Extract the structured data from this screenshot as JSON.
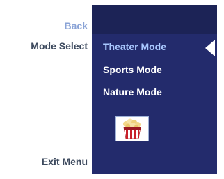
{
  "menu": {
    "back_label": "Back",
    "section_label": "Mode Select",
    "exit_label": "Exit Menu",
    "options": [
      {
        "label": "Theater Mode",
        "selected": true
      },
      {
        "label": "Sports Mode",
        "selected": false
      },
      {
        "label": "Nature Mode",
        "selected": false
      }
    ],
    "selected_icon": "popcorn-icon"
  },
  "colors": {
    "panel_bg": "#232b6c",
    "header_bg": "#1c2356",
    "highlight_text": "#a9c8ff",
    "back_text": "#8aa3d6",
    "label_text": "#3d4a5e"
  }
}
